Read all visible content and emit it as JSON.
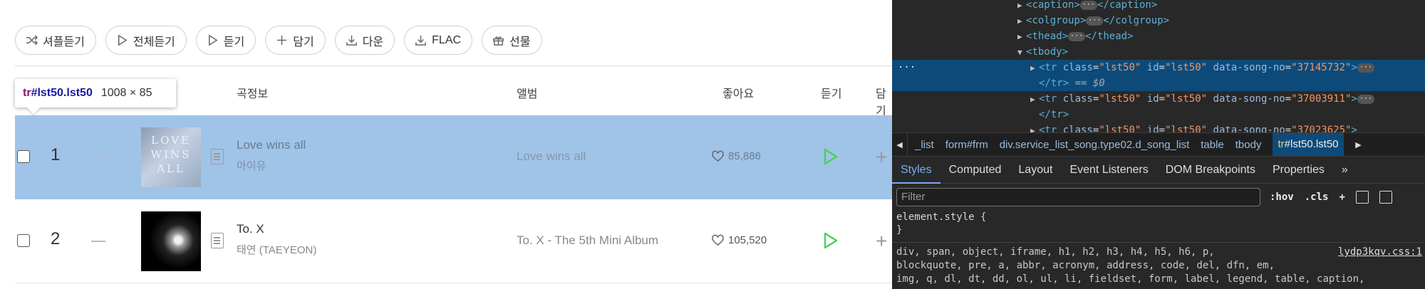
{
  "toolbar": {
    "shuffle": "셔플듣기",
    "play_all": "전체듣기",
    "listen": "듣기",
    "add": "담기",
    "download": "다운",
    "flac": "FLAC",
    "gift": "선물"
  },
  "table_header": {
    "song_info": "곡정보",
    "album": "앨범",
    "likes": "좋아요",
    "listen": "듣기",
    "add": "담기"
  },
  "tooltip": {
    "tag": "tr",
    "id_class": "#lst50.lst50",
    "size": "1008 × 85"
  },
  "songs": [
    {
      "rank": "1",
      "title": "Love wins all",
      "artist": "아이유",
      "album": "Love wins all",
      "likes": "85,886",
      "cover_text": "LOVE WINS ALL"
    },
    {
      "rank": "2",
      "title": "To. X",
      "artist": "태연 (TAEYEON)",
      "album": "To. X - The 5th Mini Album",
      "likes": "105,520"
    }
  ],
  "devtools": {
    "element_lines": [
      {
        "indent": 0,
        "arrow": "▶",
        "html": "caption"
      },
      {
        "indent": 0,
        "arrow": "▶",
        "html": "colgroup"
      },
      {
        "indent": 0,
        "arrow": "▶",
        "html": "thead"
      },
      {
        "indent": 0,
        "arrow": "▼",
        "html": "tbody"
      }
    ],
    "rows": [
      {
        "song_no": "37145732",
        "tail": "== $0"
      },
      {
        "song_no": "37003911"
      },
      {
        "song_no": "37023625"
      }
    ],
    "tr_class": "lst50",
    "tr_id": "lst50",
    "breadcrumbs": [
      "_list",
      "form#frm",
      "div.service_list_song.type02.d_song_list",
      "table",
      "tbody"
    ],
    "breadcrumb_current": {
      "tag": "tr",
      "rest": "#lst50.lst50"
    },
    "tabs": [
      "Styles",
      "Computed",
      "Layout",
      "Event Listeners",
      "DOM Breakpoints",
      "Properties"
    ],
    "active_tab": "Styles",
    "filter_placeholder": "Filter",
    "hov": ":hov",
    "cls": ".cls",
    "element_style": "element.style {",
    "element_style_close": "}",
    "rule_lines": [
      "div, span, object, iframe, h1, h2, h3, h4, h5, h6, p,",
      "blockquote, pre, a, abbr, acronym, address, code, del, dfn, em,",
      "img, q, dl, dt, dd, ol, ul, li, fieldset, form, label, legend, table, caption,"
    ],
    "rule_source": "lydp3kqv.css:1"
  },
  "colors": {
    "highlight": "#a0c3e8",
    "play_green": "#4cd05a",
    "devtools_bg": "#282828",
    "selected_node": "#0d4a7a"
  }
}
